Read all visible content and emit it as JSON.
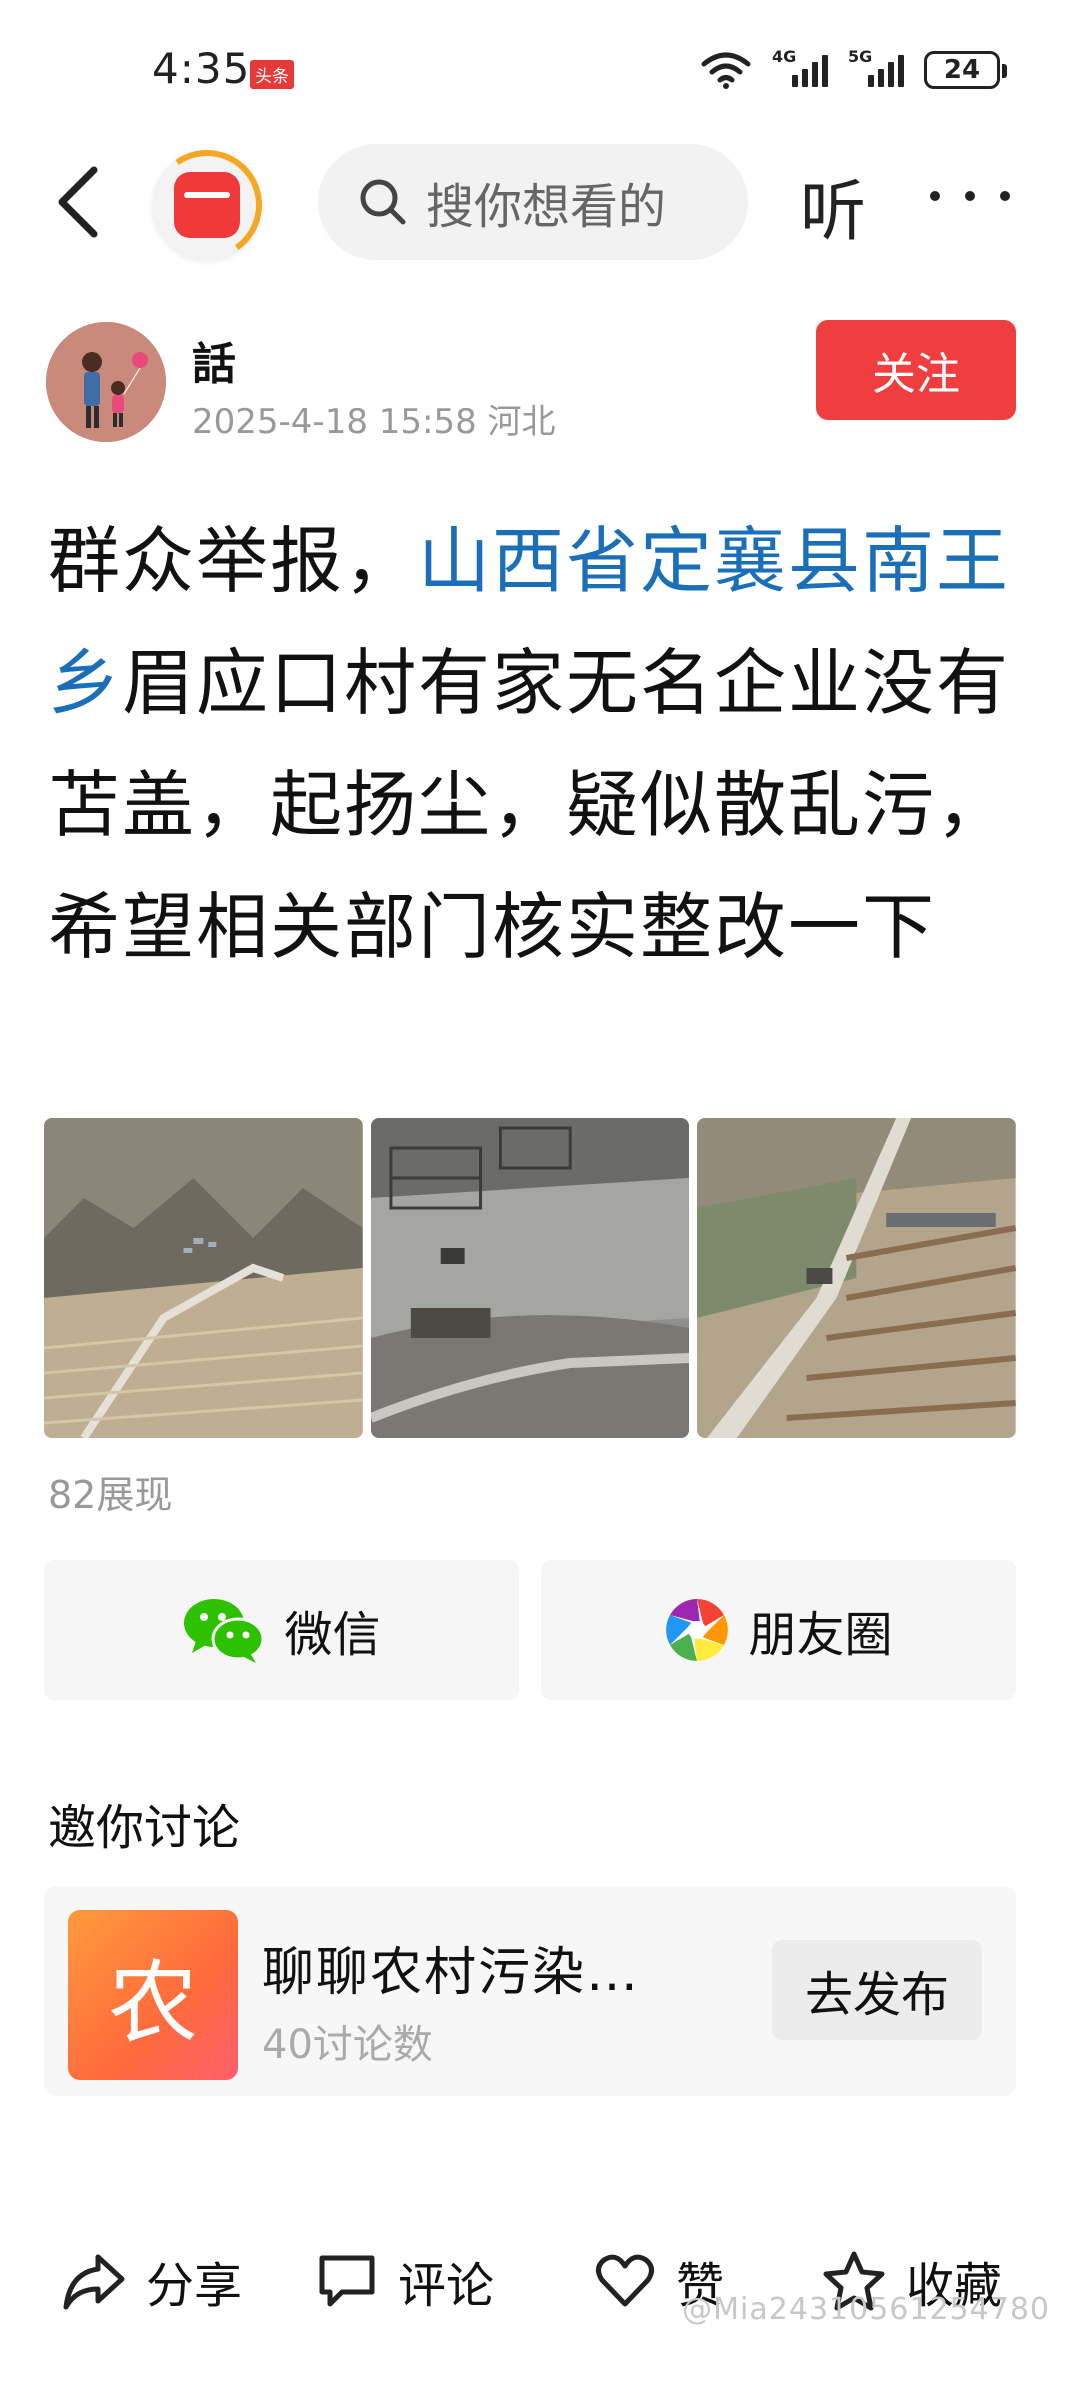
{
  "status_bar": {
    "time": "4:35",
    "app_badge": "头条",
    "net1": "4G",
    "net2": "5G",
    "battery": "24"
  },
  "nav": {
    "search_placeholder": "搜你想看的",
    "listen_label": "听"
  },
  "author": {
    "name": "話",
    "meta": "2025-4-18 15:58 河北",
    "follow_label": "关注"
  },
  "post": {
    "text_before": "群众举报，",
    "link_text": "山西省定襄县南王乡",
    "text_after": "眉应口村有家无名企业没有苫盖，起扬尘，疑似散乱污，希望相关部门核实整改一下",
    "views": "82展现"
  },
  "share": {
    "wechat_label": "微信",
    "moments_label": "朋友圈"
  },
  "discussion": {
    "title": "邀你讨论",
    "topic_icon_char": "农",
    "topic_name": "聊聊农村污染…",
    "topic_count": "40讨论数",
    "publish_label": "去发布"
  },
  "bottom_bar": {
    "share_label": "分享",
    "comment_label": "评论",
    "like_label": "赞",
    "favorite_label": "收藏"
  },
  "watermark": "@Mia2431056125478​0",
  "colors": {
    "accent_red": "#f03d3d",
    "link_blue": "#1a6fb8",
    "wechat_green": "#2dc100"
  }
}
